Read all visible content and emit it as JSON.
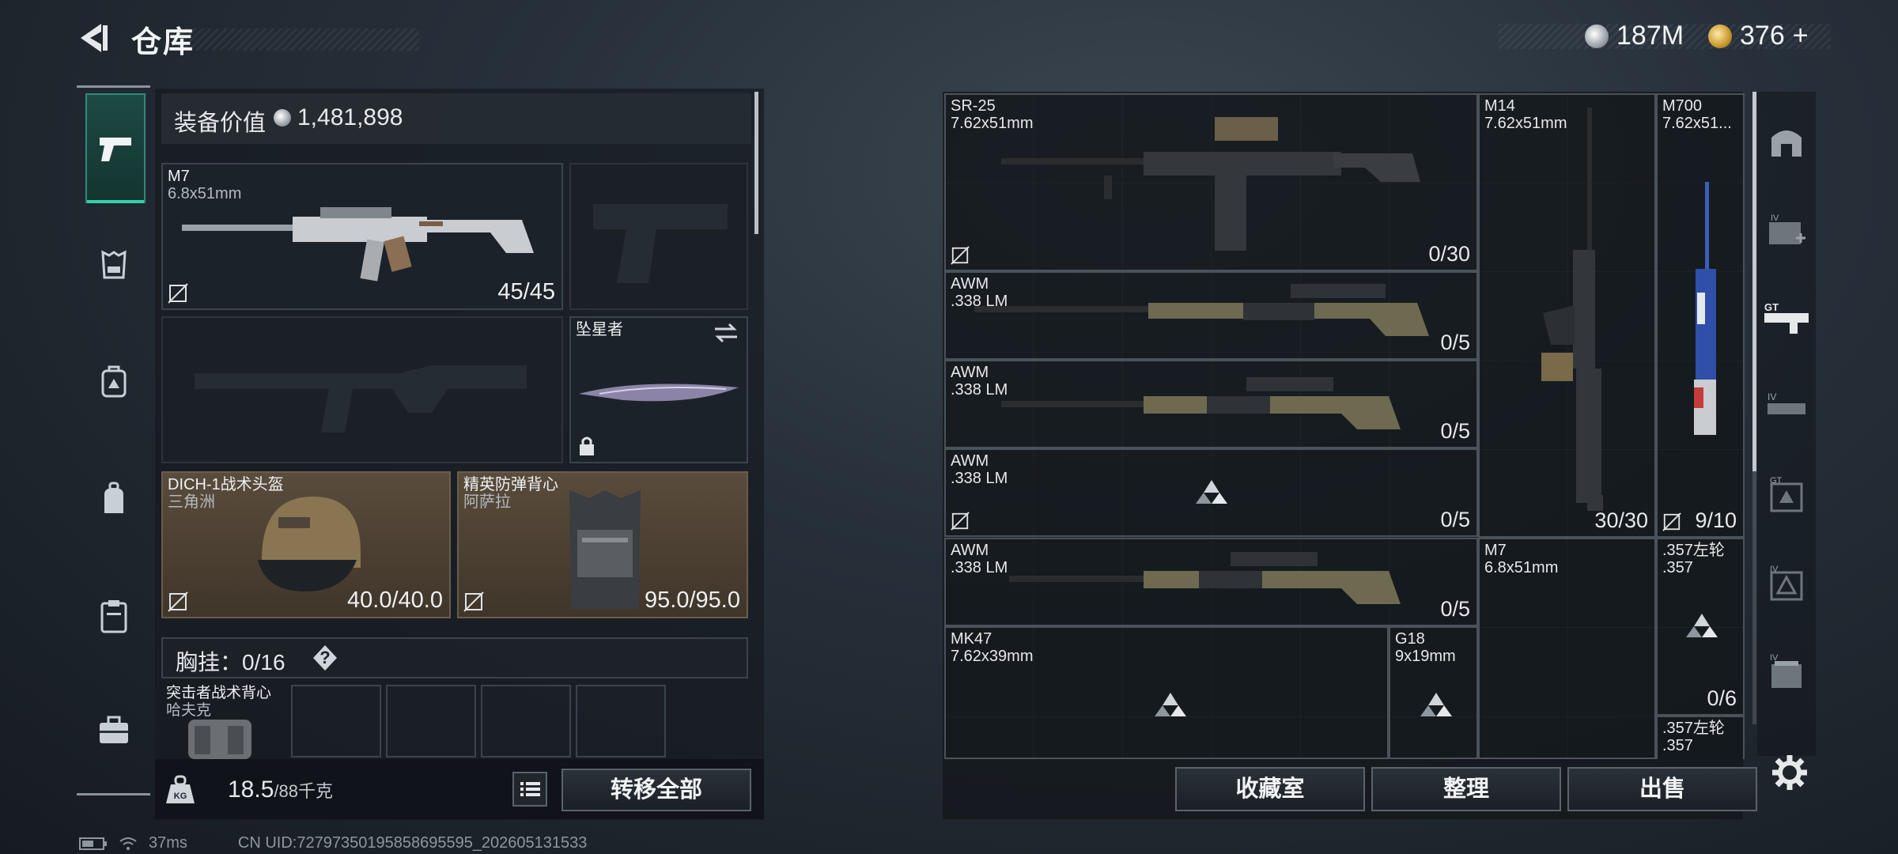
{
  "header": {
    "title": "仓库",
    "currency_silver": "187M",
    "currency_gold": "376",
    "gold_plus": "+"
  },
  "nav": {
    "items": [
      "pistol-icon",
      "armor-icon",
      "backpack-icon",
      "bag-icon",
      "locker-icon",
      "briefcase-icon"
    ]
  },
  "equipment": {
    "value_label": "装备价值",
    "value": "1,481,898",
    "primary": {
      "name": "M7",
      "caliber": "6.8x51mm",
      "ammo": "45/45"
    },
    "melee": {
      "name": "坠星者"
    },
    "helmet": {
      "name": "DICH-1战术头盔",
      "faction": "三角洲",
      "durability": "40.0/40.0"
    },
    "armor": {
      "name": "精英防弹背心",
      "faction": "阿萨拉",
      "durability": "95.0/95.0"
    },
    "chest_label": "胸挂：",
    "chest_count": "0/16",
    "help": "?",
    "rig": {
      "name": "突击者战术背心",
      "faction": "哈夫克"
    },
    "weight": "18.5",
    "weight_max": "/88千克",
    "transfer_all": "转移全部"
  },
  "grid_items": [
    {
      "name": "SR-25",
      "caliber": "7.62x51mm",
      "count": "0/30"
    },
    {
      "name": "M14",
      "caliber": "7.62x51mm",
      "count": "30/30"
    },
    {
      "name": "M700",
      "caliber": "7.62x51...",
      "count": "9/10"
    },
    {
      "name": "AWM",
      "caliber": ".338 LM",
      "count": "0/5"
    },
    {
      "name": "AWM",
      "caliber": ".338 LM",
      "count": "0/5"
    },
    {
      "name": "AWM",
      "caliber": ".338 LM",
      "count": "0/5"
    },
    {
      "name": "AWM",
      "caliber": ".338 LM",
      "count": "0/5"
    },
    {
      "name": "M7",
      "caliber": "6.8x51mm",
      "count": ""
    },
    {
      "name": ".357左轮",
      "caliber": ".357",
      "count": "0/6"
    },
    {
      "name": "MK47",
      "caliber": "7.62x39mm",
      "count": ""
    },
    {
      "name": "G18",
      "caliber": "9x19mm",
      "count": ""
    },
    {
      "name": ".357左轮",
      "caliber": ".357",
      "count": ""
    }
  ],
  "actions": {
    "collection": "收藏室",
    "organize": "整理",
    "sell": "出售"
  },
  "status": {
    "ping": "37ms",
    "uid": "CN UID:72797350195858695595_202605131533"
  },
  "colors": {
    "accent": "#33d1ad",
    "slot_brown": "#5a4c3c"
  }
}
